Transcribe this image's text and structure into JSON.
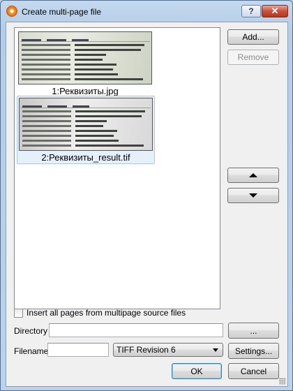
{
  "window": {
    "title": "Create multi-page file",
    "help_label": "?",
    "close_label": "✕"
  },
  "pages": [
    {
      "caption": "1:Реквизиты.jpg",
      "selected": false
    },
    {
      "caption": "2:Реквизиты_result.tif",
      "selected": true
    }
  ],
  "side_buttons": {
    "add_label": "Add...",
    "remove_label": "Remove",
    "remove_enabled": false
  },
  "options": {
    "insert_all_label": "Insert all pages from multipage source files",
    "insert_all_checked": false
  },
  "directory": {
    "label": "Directory",
    "value": "",
    "browse_label": "..."
  },
  "filename": {
    "label": "Filename",
    "value": "",
    "format_selected": "TIFF Revision 6",
    "settings_label": "Settings..."
  },
  "footer": {
    "ok_label": "OK",
    "cancel_label": "Cancel"
  },
  "colors": {
    "close_button": "#c8523d",
    "selected_item_bg": "#e6f0fb",
    "default_button_border": "#3c7fb1"
  }
}
